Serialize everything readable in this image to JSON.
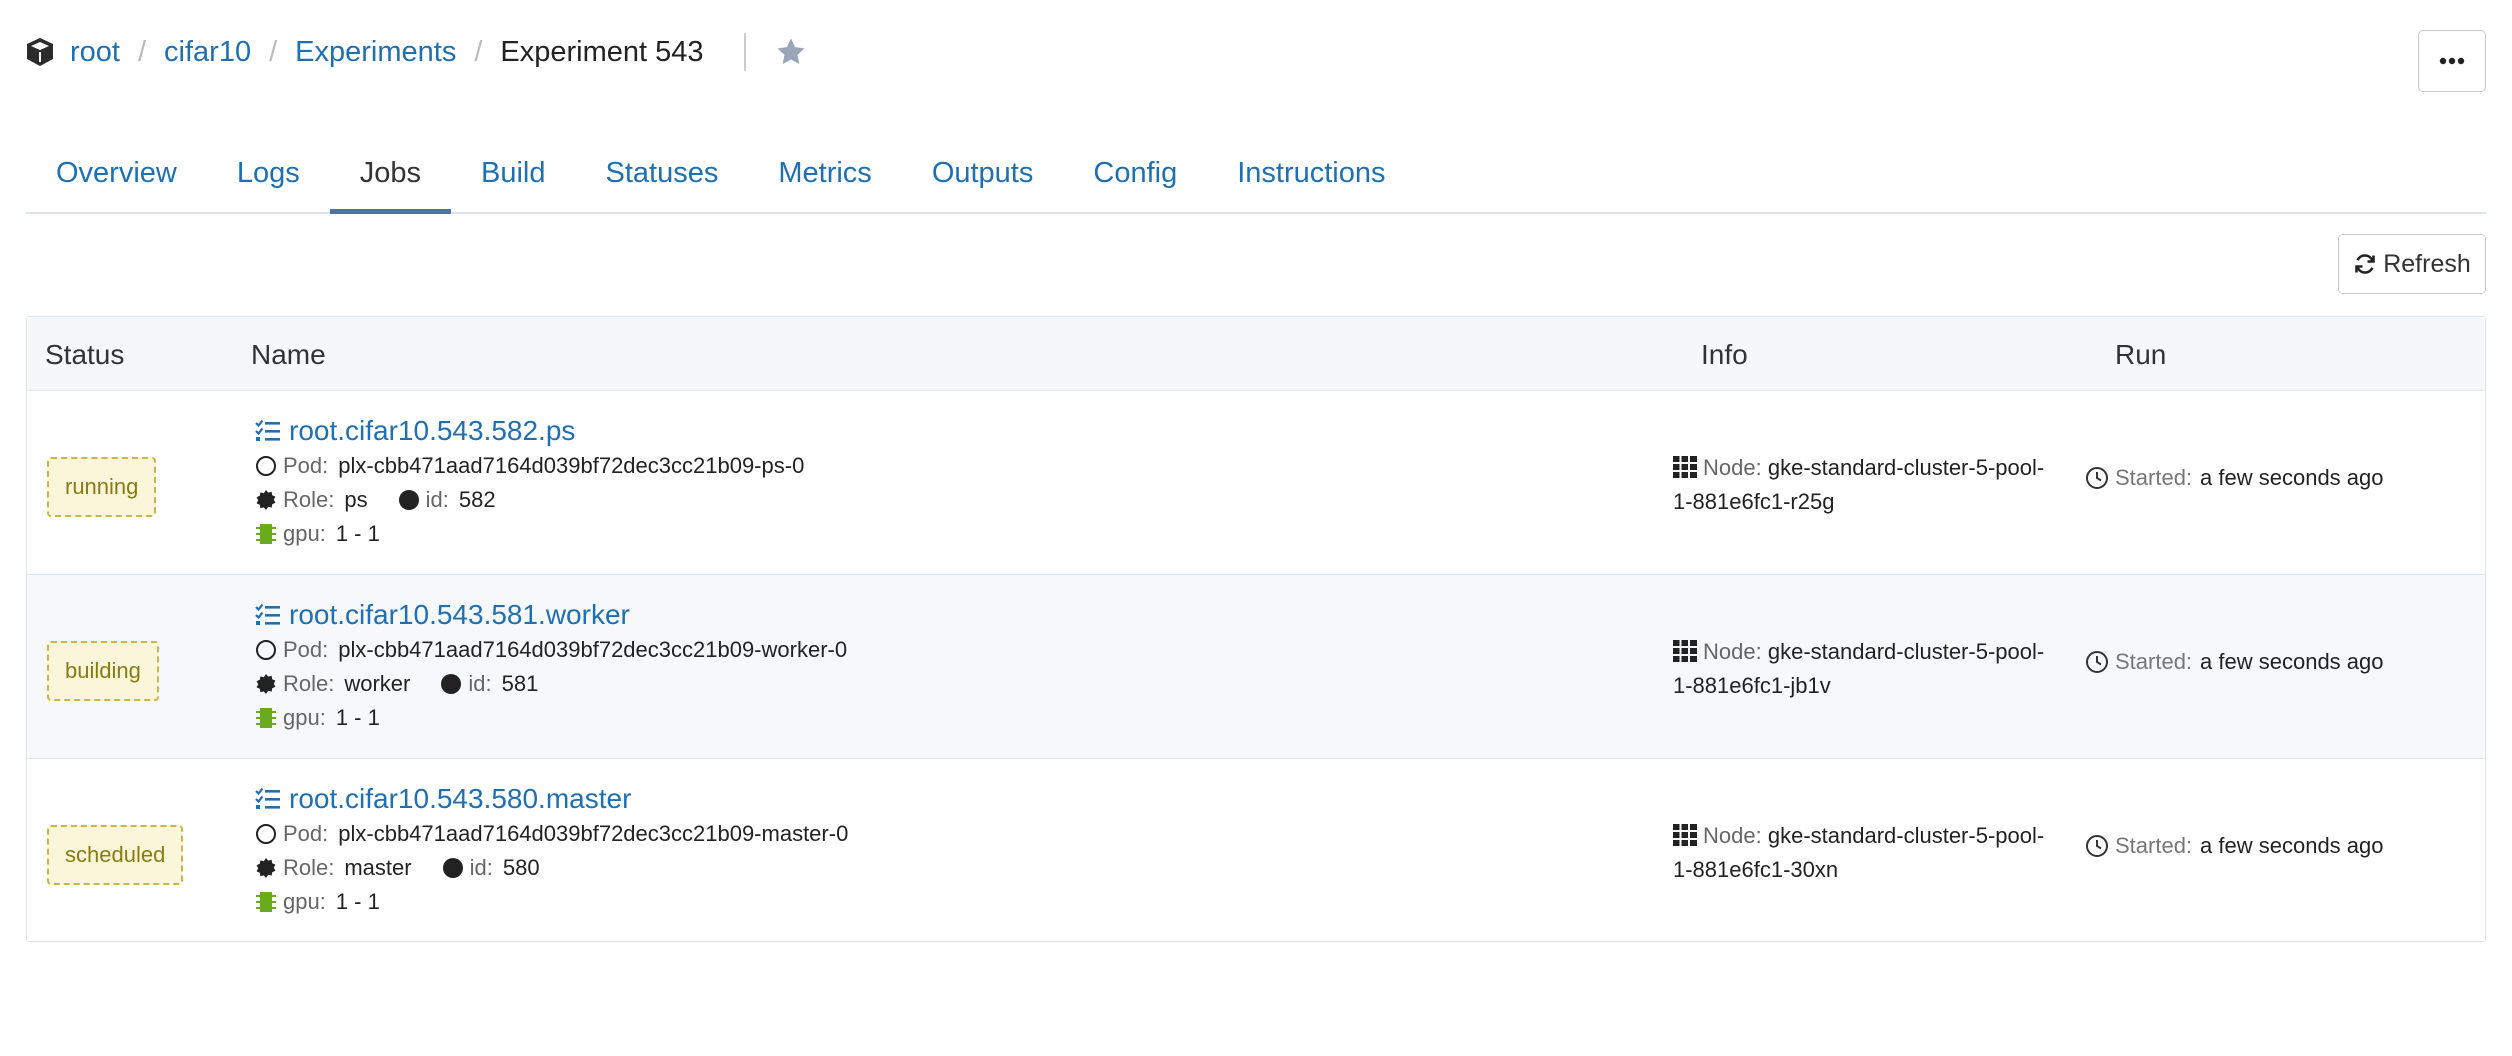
{
  "breadcrumb": {
    "items": [
      "root",
      "cifar10",
      "Experiments"
    ],
    "current": "Experiment 543",
    "separator": "/"
  },
  "tabs": [
    {
      "label": "Overview",
      "active": false
    },
    {
      "label": "Logs",
      "active": false
    },
    {
      "label": "Jobs",
      "active": true
    },
    {
      "label": "Build",
      "active": false
    },
    {
      "label": "Statuses",
      "active": false
    },
    {
      "label": "Metrics",
      "active": false
    },
    {
      "label": "Outputs",
      "active": false
    },
    {
      "label": "Config",
      "active": false
    },
    {
      "label": "Instructions",
      "active": false
    }
  ],
  "toolbar": {
    "refresh_label": "Refresh"
  },
  "table": {
    "headers": {
      "status": "Status",
      "name": "Name",
      "info": "Info",
      "run": "Run"
    },
    "labels": {
      "pod": "Pod:",
      "role": "Role:",
      "id": "id:",
      "gpu": "gpu:",
      "node": "Node:",
      "started": "Started:"
    },
    "rows": [
      {
        "status": "running",
        "name": "root.cifar10.543.582.ps",
        "pod": "plx-cbb471aad7164d039bf72dec3cc21b09-ps-0",
        "role": "ps",
        "id": "582",
        "gpu": "1 - 1",
        "node_line1": "gke-standard-cluster-5-pool-",
        "node_line2": "1-881e6fc1-r25g",
        "started": "a few seconds ago"
      },
      {
        "status": "building",
        "name": "root.cifar10.543.581.worker",
        "pod": "plx-cbb471aad7164d039bf72dec3cc21b09-worker-0",
        "role": "worker",
        "id": "581",
        "gpu": "1 - 1",
        "node_line1": "gke-standard-cluster-5-pool-",
        "node_line2": "1-881e6fc1-jb1v",
        "started": "a few seconds ago"
      },
      {
        "status": "scheduled",
        "name": "root.cifar10.543.580.master",
        "pod": "plx-cbb471aad7164d039bf72dec3cc21b09-master-0",
        "role": "master",
        "id": "580",
        "gpu": "1 - 1",
        "node_line1": "gke-standard-cluster-5-pool-",
        "node_line2": "1-881e6fc1-30xn",
        "started": "a few seconds ago"
      }
    ]
  },
  "colors": {
    "link": "#1f6fb3",
    "badge_bg": "#fbf6d9",
    "badge_border": "#c9b744",
    "gpu_icon": "#6aab1e",
    "tab_indicator": "#4b73a8"
  },
  "icons": {
    "brand": "cube-icon",
    "star": "star-icon",
    "more": "ellipsis-icon",
    "refresh": "refresh-icon",
    "job": "tasks-icon",
    "pod": "circle-outline-icon",
    "role": "gear-badge-icon",
    "id": "circle-filled-icon",
    "gpu": "gpu-chip-icon",
    "node": "grid-icon",
    "started": "clock-icon"
  }
}
